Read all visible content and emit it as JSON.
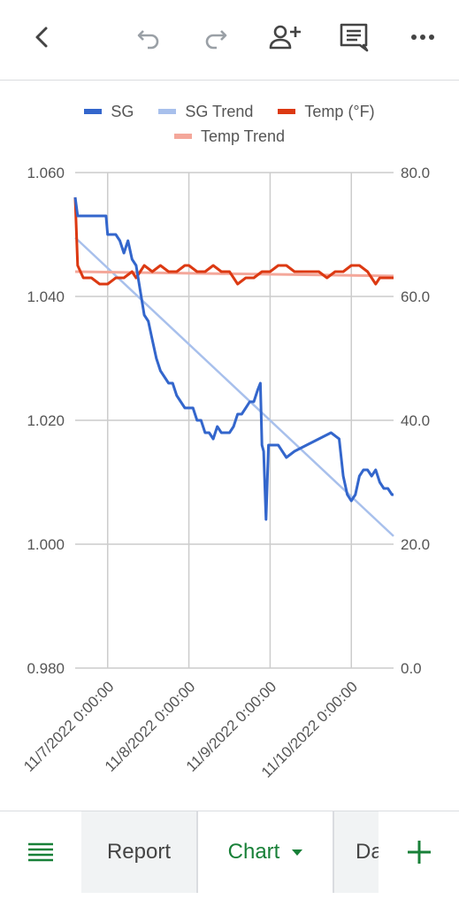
{
  "toolbar": {
    "icons": [
      "back-icon",
      "undo-icon",
      "redo-icon",
      "add-person-icon",
      "comment-icon",
      "more-icon"
    ]
  },
  "colors": {
    "sg": "#3366cc",
    "sg_trend": "#a8c0ec",
    "temp": "#dc3912",
    "temp_trend": "#f4a79a",
    "accent": "#188038"
  },
  "chart_data": {
    "type": "line",
    "title": "",
    "series": [
      {
        "name": "SG",
        "axis": "left",
        "points": [
          [
            -0.4,
            1.056
          ],
          [
            -0.37,
            1.053
          ],
          [
            -0.3,
            1.053
          ],
          [
            -0.2,
            1.053
          ],
          [
            -0.02,
            1.053
          ],
          [
            0,
            1.05
          ],
          [
            0.1,
            1.05
          ],
          [
            0.15,
            1.049
          ],
          [
            0.2,
            1.047
          ],
          [
            0.25,
            1.049
          ],
          [
            0.3,
            1.046
          ],
          [
            0.35,
            1.045
          ],
          [
            0.4,
            1.041
          ],
          [
            0.45,
            1.037
          ],
          [
            0.5,
            1.036
          ],
          [
            0.55,
            1.033
          ],
          [
            0.6,
            1.03
          ],
          [
            0.65,
            1.028
          ],
          [
            0.7,
            1.027
          ],
          [
            0.75,
            1.026
          ],
          [
            0.8,
            1.026
          ],
          [
            0.85,
            1.024
          ],
          [
            0.9,
            1.023
          ],
          [
            0.95,
            1.022
          ],
          [
            1.0,
            1.022
          ],
          [
            1.05,
            1.022
          ],
          [
            1.1,
            1.02
          ],
          [
            1.15,
            1.02
          ],
          [
            1.2,
            1.018
          ],
          [
            1.25,
            1.018
          ],
          [
            1.3,
            1.017
          ],
          [
            1.35,
            1.019
          ],
          [
            1.4,
            1.018
          ],
          [
            1.45,
            1.018
          ],
          [
            1.5,
            1.018
          ],
          [
            1.55,
            1.019
          ],
          [
            1.6,
            1.021
          ],
          [
            1.65,
            1.021
          ],
          [
            1.7,
            1.022
          ],
          [
            1.75,
            1.023
          ],
          [
            1.8,
            1.023
          ],
          [
            1.85,
            1.025
          ],
          [
            1.88,
            1.026
          ],
          [
            1.9,
            1.016
          ],
          [
            1.92,
            1.015
          ],
          [
            1.95,
            1.004
          ],
          [
            1.98,
            1.016
          ],
          [
            2.05,
            1.016
          ],
          [
            2.1,
            1.016
          ],
          [
            2.15,
            1.015
          ],
          [
            2.2,
            1.014
          ],
          [
            2.3,
            1.015
          ],
          [
            2.45,
            1.016
          ],
          [
            2.6,
            1.017
          ],
          [
            2.75,
            1.018
          ],
          [
            2.85,
            1.017
          ],
          [
            2.9,
            1.011
          ],
          [
            2.95,
            1.008
          ],
          [
            3.0,
            1.007
          ],
          [
            3.05,
            1.008
          ],
          [
            3.1,
            1.011
          ],
          [
            3.15,
            1.012
          ],
          [
            3.2,
            1.012
          ],
          [
            3.25,
            1.011
          ],
          [
            3.3,
            1.012
          ],
          [
            3.35,
            1.01
          ],
          [
            3.4,
            1.009
          ],
          [
            3.45,
            1.009
          ],
          [
            3.5,
            1.008
          ],
          [
            3.52,
            1.008
          ]
        ]
      },
      {
        "name": "SG Trend",
        "axis": "left",
        "points": [
          [
            -0.4,
            1.0495
          ],
          [
            3.52,
            1.0013
          ]
        ]
      },
      {
        "name": "Temp (°F)",
        "axis": "right",
        "points": [
          [
            -0.4,
            76
          ],
          [
            -0.37,
            65
          ],
          [
            -0.3,
            63
          ],
          [
            -0.2,
            63
          ],
          [
            -0.1,
            62
          ],
          [
            0,
            62
          ],
          [
            0.1,
            63
          ],
          [
            0.2,
            63
          ],
          [
            0.3,
            64
          ],
          [
            0.35,
            63
          ],
          [
            0.45,
            65
          ],
          [
            0.55,
            64
          ],
          [
            0.65,
            65
          ],
          [
            0.75,
            64
          ],
          [
            0.85,
            64
          ],
          [
            0.95,
            65
          ],
          [
            1.0,
            65
          ],
          [
            1.1,
            64
          ],
          [
            1.2,
            64
          ],
          [
            1.3,
            65
          ],
          [
            1.4,
            64
          ],
          [
            1.5,
            64
          ],
          [
            1.6,
            62
          ],
          [
            1.7,
            63
          ],
          [
            1.8,
            63
          ],
          [
            1.9,
            64
          ],
          [
            2.0,
            64
          ],
          [
            2.1,
            65
          ],
          [
            2.2,
            65
          ],
          [
            2.3,
            64
          ],
          [
            2.4,
            64
          ],
          [
            2.5,
            64
          ],
          [
            2.6,
            64
          ],
          [
            2.7,
            63
          ],
          [
            2.8,
            64
          ],
          [
            2.9,
            64
          ],
          [
            3.0,
            65
          ],
          [
            3.1,
            65
          ],
          [
            3.2,
            64
          ],
          [
            3.3,
            62
          ],
          [
            3.35,
            63
          ],
          [
            3.45,
            63
          ],
          [
            3.52,
            63
          ]
        ]
      },
      {
        "name": "Temp Trend",
        "axis": "right",
        "points": [
          [
            -0.4,
            64
          ],
          [
            3.52,
            63.3
          ]
        ]
      }
    ],
    "x_categories": [
      "11/7/2022 0:00:00",
      "11/8/2022 0:00:00",
      "11/9/2022 0:00:00",
      "11/10/2022 0:00:00"
    ],
    "x_tick_values": [
      0,
      1,
      2,
      3
    ],
    "xlim": [
      -0.4,
      3.52
    ],
    "left_axis": {
      "min": 0.98,
      "max": 1.06,
      "ticks": [
        "0.980",
        "1.000",
        "1.020",
        "1.040",
        "1.060"
      ]
    },
    "right_axis": {
      "min": 0.0,
      "max": 80.0,
      "ticks": [
        "0.0",
        "20.0",
        "40.0",
        "60.0",
        "80.0"
      ]
    },
    "legend": {
      "placement": "top"
    },
    "grid": true
  },
  "bottom": {
    "tabs": [
      {
        "label": "Report"
      },
      {
        "label": "Chart"
      },
      {
        "label": "Da"
      }
    ]
  }
}
